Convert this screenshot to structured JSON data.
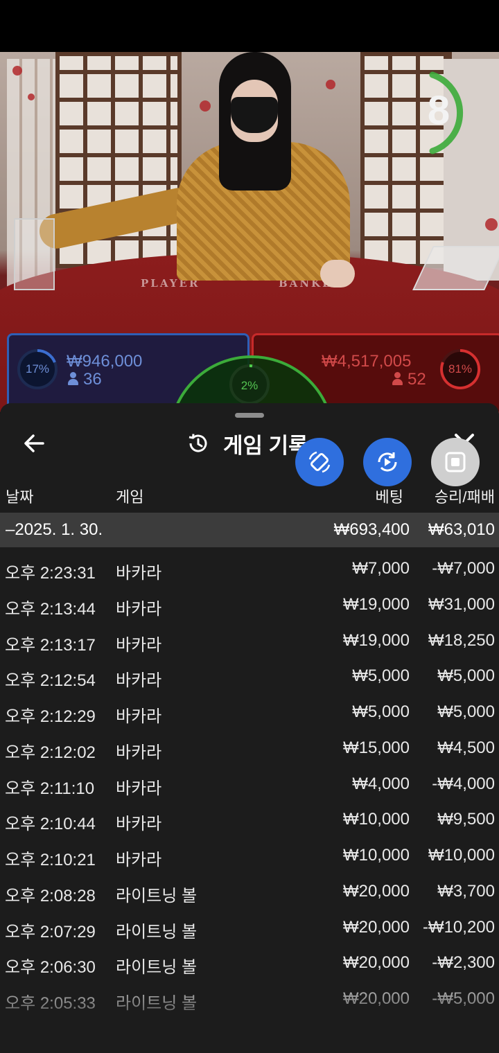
{
  "live": {
    "timer": "8",
    "felt_player": "PLAYER",
    "felt_banker": "BANKER",
    "player": {
      "pct": "17%",
      "amount": "₩946,000",
      "count": "36"
    },
    "tie": {
      "pct": "2%"
    },
    "banker": {
      "pct": "81%",
      "amount": "₩4,517,005",
      "count": "52"
    }
  },
  "sheet": {
    "title": "게임 기록",
    "columns": {
      "date": "날짜",
      "game": "게임",
      "bet": "베팅",
      "winloss": "승리/패배"
    },
    "day": {
      "label": "–2025. 1. 30.",
      "bet": "₩693,400",
      "winloss": "₩63,010"
    },
    "rows": [
      {
        "time": "오후 2:23:31",
        "game": "바카라",
        "bet": "₩7,000",
        "winloss": "-₩7,000"
      },
      {
        "time": "오후 2:13:44",
        "game": "바카라",
        "bet": "₩19,000",
        "winloss": "₩31,000"
      },
      {
        "time": "오후 2:13:17",
        "game": "바카라",
        "bet": "₩19,000",
        "winloss": "₩18,250"
      },
      {
        "time": "오후 2:12:54",
        "game": "바카라",
        "bet": "₩5,000",
        "winloss": "₩5,000"
      },
      {
        "time": "오후 2:12:29",
        "game": "바카라",
        "bet": "₩5,000",
        "winloss": "₩5,000"
      },
      {
        "time": "오후 2:12:02",
        "game": "바카라",
        "bet": "₩15,000",
        "winloss": "₩4,500"
      },
      {
        "time": "오후 2:11:10",
        "game": "바카라",
        "bet": "₩4,000",
        "winloss": "-₩4,000"
      },
      {
        "time": "오후 2:10:44",
        "game": "바카라",
        "bet": "₩10,000",
        "winloss": "₩9,500"
      },
      {
        "time": "오후 2:10:21",
        "game": "바카라",
        "bet": "₩10,000",
        "winloss": "₩10,000"
      },
      {
        "time": "오후 2:08:28",
        "game": "라이트닝 볼",
        "bet": "₩20,000",
        "winloss": "₩3,700"
      },
      {
        "time": "오후 2:07:29",
        "game": "라이트닝 볼",
        "bet": "₩20,000",
        "winloss": "-₩10,200"
      },
      {
        "time": "오후 2:06:30",
        "game": "라이트닝 볼",
        "bet": "₩20,000",
        "winloss": "-₩2,300"
      },
      {
        "time": "오후 2:05:33",
        "game": "라이트닝 볼",
        "bet": "₩20,000",
        "winloss": "-₩5,000"
      }
    ]
  },
  "colors": {
    "player": "#2f5fb6",
    "banker": "#c72a2a",
    "tie": "#3cab3a",
    "float_blue": "#2f6fde"
  },
  "icons": [
    "back-arrow-icon",
    "history-icon",
    "close-icon",
    "rotate-screen-icon",
    "replay-icon",
    "stop-icon",
    "user-icon"
  ]
}
